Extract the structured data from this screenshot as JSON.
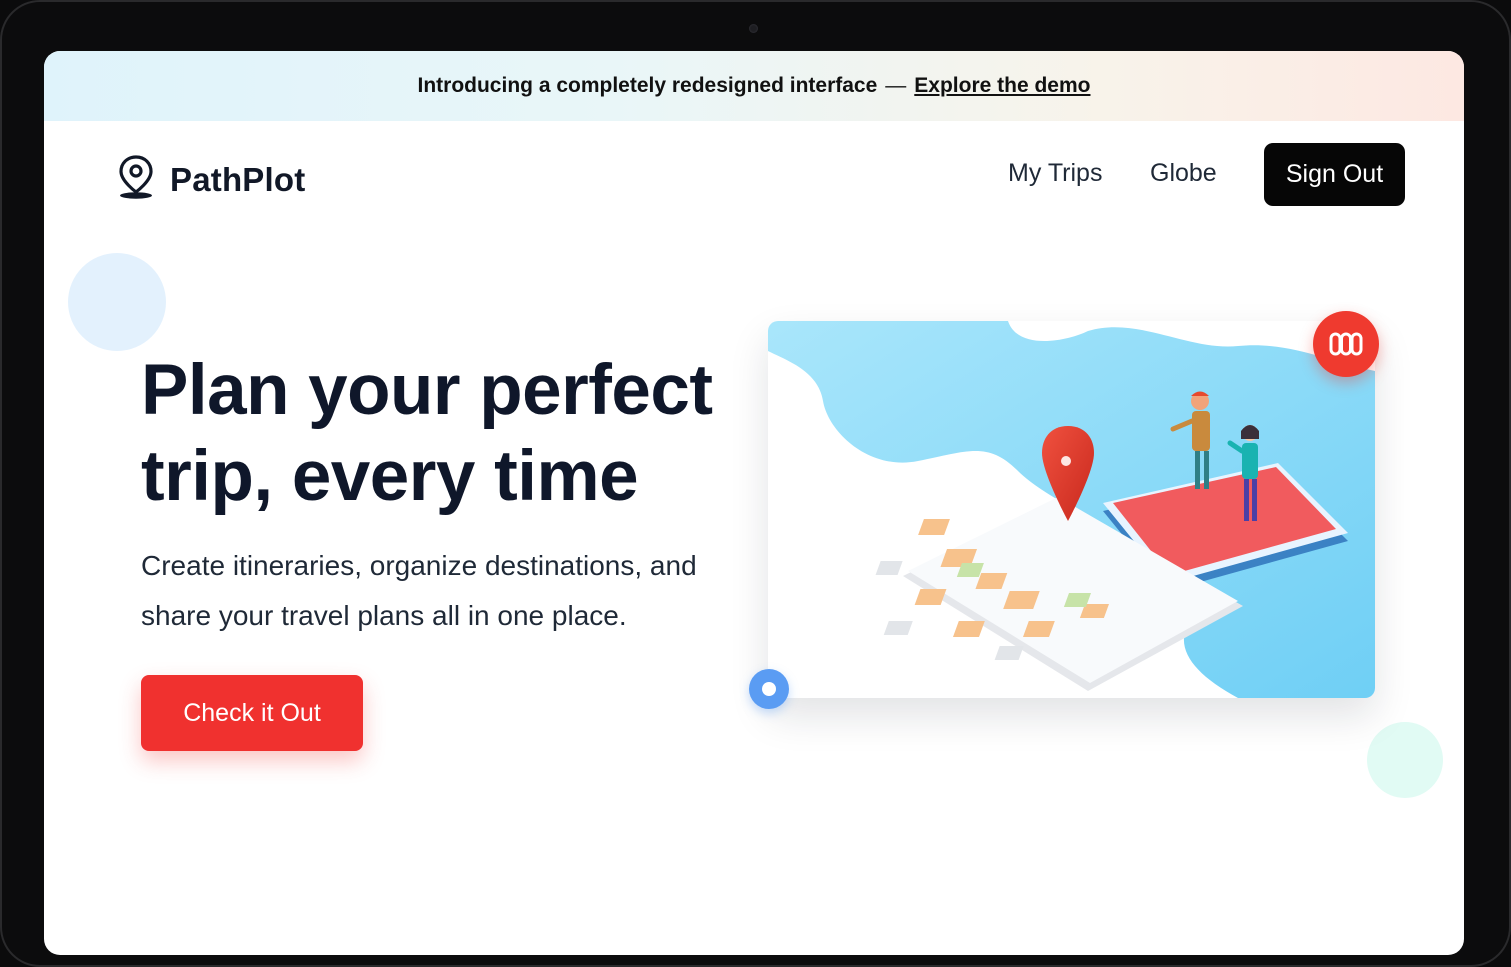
{
  "banner": {
    "text": "Introducing a completely redesigned interface",
    "dash": "—",
    "link": "Explore the demo"
  },
  "brand": {
    "name": "PathPlot",
    "icon": "map-pin-icon"
  },
  "nav": {
    "links": [
      "My Trips",
      "Globe"
    ],
    "sign_out": "Sign Out"
  },
  "hero": {
    "headline_line1": "Plan your perfect",
    "headline_line2": "trip, every time",
    "subtext_line1": "Create itineraries, organize destinations, and",
    "subtext_line2": "share your travel plans all in one place.",
    "cta": "Check it Out"
  },
  "illustration": {
    "badge_icon": "three-columns-icon",
    "dot_icon": "ring-dot-icon"
  },
  "colors": {
    "accent_red": "#f0312f",
    "dark": "#0f172a",
    "sky_blue": "#7dd3f5",
    "ring_blue": "#5a9cf3"
  }
}
